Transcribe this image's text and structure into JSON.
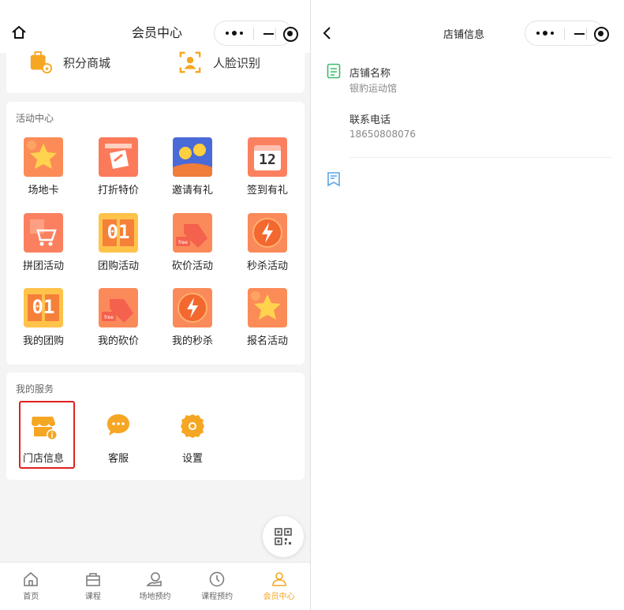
{
  "left": {
    "title": "会员中心",
    "top_items": [
      {
        "label": "积分商城",
        "icon": "shopping-bag-icon"
      },
      {
        "label": "人脸识别",
        "icon": "face-scan-icon"
      }
    ],
    "activity": {
      "header": "活动中心",
      "items": [
        {
          "label": "场地卡",
          "icon": "star-card-icon",
          "tile": ""
        },
        {
          "label": "打折特价",
          "icon": "discount-calendar-icon",
          "tile": ""
        },
        {
          "label": "邀请有礼",
          "icon": "coins-invite-icon",
          "tile": ""
        },
        {
          "label": "签到有礼",
          "icon": "calendar-12-icon",
          "tile": "12"
        },
        {
          "label": "拼团活动",
          "icon": "cart-icon",
          "tile": ""
        },
        {
          "label": "团购活动",
          "icon": "number-01-icon",
          "tile": "01"
        },
        {
          "label": "砍价活动",
          "icon": "price-tag-icon",
          "tile": ""
        },
        {
          "label": "秒杀活动",
          "icon": "lightning-clock-icon",
          "tile": ""
        },
        {
          "label": "我的团购",
          "icon": "number-01-icon",
          "tile": "01"
        },
        {
          "label": "我的砍价",
          "icon": "price-tag-icon",
          "tile": ""
        },
        {
          "label": "我的秒杀",
          "icon": "lightning-clock-icon",
          "tile": ""
        },
        {
          "label": "报名活动",
          "icon": "star-card-icon",
          "tile": ""
        }
      ]
    },
    "services": {
      "header": "我的服务",
      "items": [
        {
          "label": "门店信息",
          "icon": "store-info-icon"
        },
        {
          "label": "客服",
          "icon": "chat-bubble-icon"
        },
        {
          "label": "设置",
          "icon": "gear-icon"
        }
      ]
    },
    "tabbar": [
      {
        "label": "首页",
        "icon": "home-icon",
        "active": false
      },
      {
        "label": "课程",
        "icon": "bag-icon",
        "active": false
      },
      {
        "label": "场地预约",
        "icon": "venue-icon",
        "active": false
      },
      {
        "label": "课程预约",
        "icon": "clock-icon",
        "active": false
      },
      {
        "label": "会员中心",
        "icon": "user-icon",
        "active": true
      }
    ]
  },
  "right": {
    "title": "店铺信息",
    "store_name_label": "店铺名称",
    "store_name_value": "银豹运动馆",
    "phone_label": "联系电话",
    "phone_value": "18650808076"
  },
  "colors": {
    "accent": "#f5a623",
    "tile_orange": "#fa7b5a",
    "highlight_red": "#e02020",
    "doc_green": "#3dbb6b",
    "doc_blue": "#5aa7e8"
  }
}
